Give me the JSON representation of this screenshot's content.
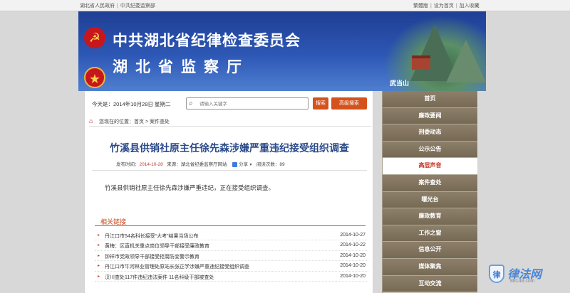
{
  "topbar": {
    "left_links": [
      "湖北省人民政府",
      "中共纪委监察部"
    ],
    "right_links": [
      "繁體版",
      "设为首页",
      "加入收藏"
    ]
  },
  "banner": {
    "title1": "中共湖北省纪律检查委员会",
    "title2": "湖北省监察厅",
    "mountain_label": "武当山"
  },
  "datebar": {
    "date": "今天是：2014年10月28日 星期二",
    "search_placeholder": "请输入关键字",
    "search_label": "搜索",
    "advanced_label": "高级搜索"
  },
  "breadcrumb": "您现在的位置：首页 > 案件查处",
  "article": {
    "title": "竹溪县供销社原主任徐先森涉嫌严重违纪接受组织调查",
    "publish_label": "发布时间：",
    "publish_date": "2014-10-28",
    "source": "来源：湖北省纪委监察厅网站",
    "share": "分享",
    "views": "阅读次数：89",
    "body": "竹溪县供销社原主任徐先森涉嫌严重违纪，正在接受组织调查。"
  },
  "related": {
    "heading": "相关链接",
    "items": [
      {
        "title": "丹江口市54名科长接受“大考”结果当场公布",
        "date": "2014-10-27"
      },
      {
        "title": "黄梅：区直机关重点岗位领导干部接受廉政教育",
        "date": "2014-10-22"
      },
      {
        "title": "钟祥市党政领导干部接受拒腐防变警示教育",
        "date": "2014-10-20"
      },
      {
        "title": "丹江口市牛河林业管理处原站长张正学涉嫌严重违纪接受组织调查",
        "date": "2014-10-20"
      },
      {
        "title": "汉川查处117件违纪违法案件 11名科级干部被查处",
        "date": "2014-10-20"
      }
    ]
  },
  "sidenav": {
    "items": [
      "首页",
      "廉政要闻",
      "刑委动态",
      "公示公告",
      "高层声音",
      "案件查处",
      "曝光台",
      "廉政教育",
      "工作之窗",
      "信息公开",
      "媒体聚焦",
      "互动交流"
    ],
    "active_index": 4
  },
  "watermark": {
    "icon_text": "律",
    "name": "律法网",
    "url": "88148.com"
  },
  "colors": {
    "banner_blue": "#1f3f94",
    "accent_orange": "#d4521c",
    "headline_blue": "#2a4a8a",
    "nav_brown": "#776a55"
  }
}
